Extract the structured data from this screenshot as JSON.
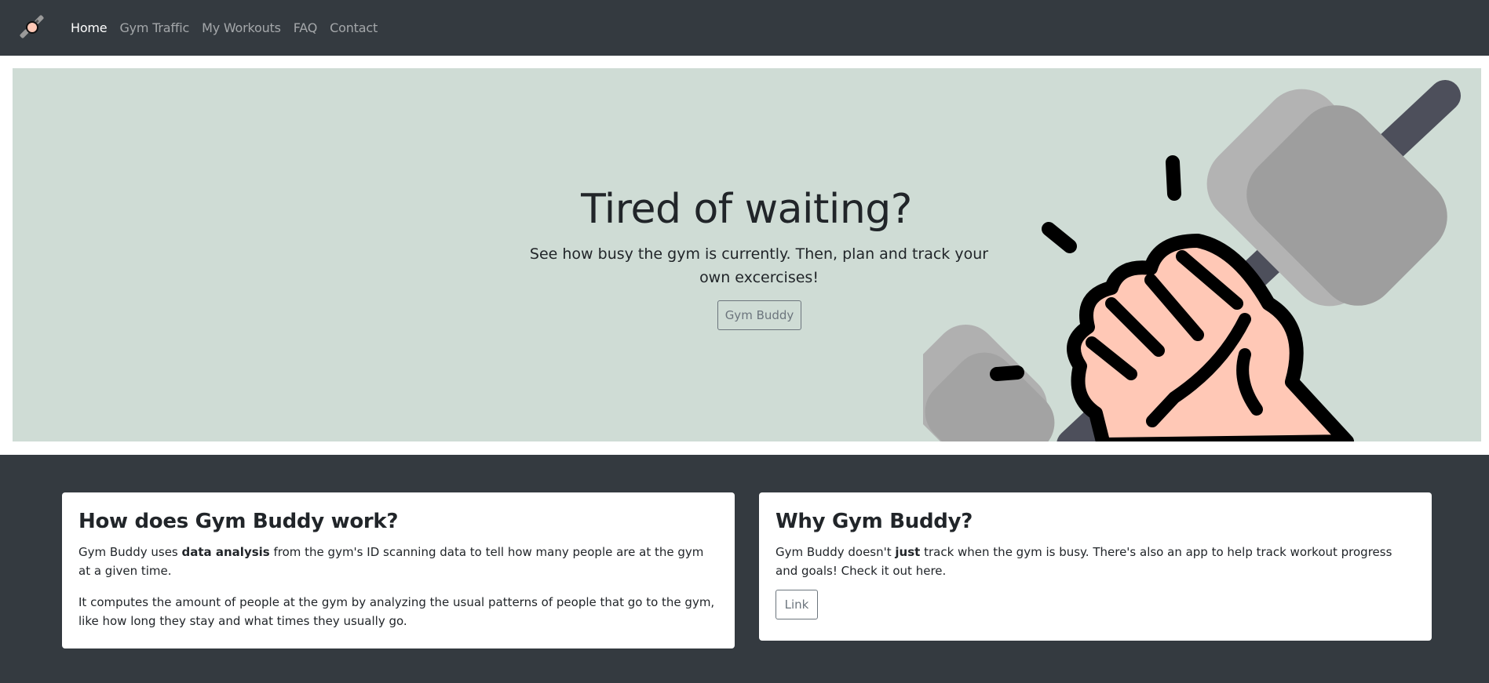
{
  "nav": {
    "brand_icon": "gym-fist-dumbbell-logo",
    "links": [
      {
        "label": "Home",
        "active": true
      },
      {
        "label": "Gym Traffic",
        "active": false
      },
      {
        "label": "My Workouts",
        "active": false
      },
      {
        "label": "FAQ",
        "active": false
      },
      {
        "label": "Contact",
        "active": false
      }
    ]
  },
  "hero": {
    "title": "Tired of waiting?",
    "lead": "See how busy the gym is currently. Then, plan and track your own excercises!",
    "button_label": "Gym Buddy",
    "illustration_icon": "fist-holding-dumbbell-icon"
  },
  "cards": {
    "how": {
      "title": "How does Gym Buddy work?",
      "p1_before": "Gym Buddy uses ",
      "p1_bold": "data analysis",
      "p1_after": " from the gym's ID scanning data to tell how many people are at the gym at a given time.",
      "p2": "It computes the amount of people at the gym by analyzing the usual patterns of people that go to the gym, like how long they stay and what times they usually go."
    },
    "why": {
      "title": "Why Gym Buddy?",
      "p1_before": "Gym Buddy doesn't ",
      "p1_bold": "just",
      "p1_after": " track when the gym is busy. There's also an app to help track workout progress and goals! Check it out here.",
      "button_label": "Link"
    }
  },
  "colors": {
    "navbar_bg": "#343a40",
    "hero_bg": "#cfdcd5",
    "skin": "#ffc8b6",
    "weight_gray": "#a9a9a9",
    "bar_dark": "#4d4f5b"
  }
}
